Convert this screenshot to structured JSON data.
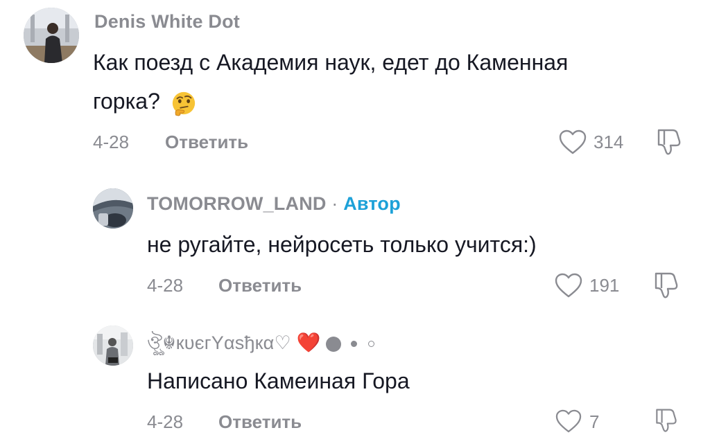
{
  "comments": [
    {
      "username": "Denis White Dot",
      "text_line1": "Как поезд с Академия наук, едет до Каменная",
      "text_line2": "горка?",
      "emoji": "thinking-face-icon",
      "date": "4-28",
      "reply_label": "Ответить",
      "likes": "314"
    },
    {
      "username": "TOMORROW_LAND",
      "separator": "·",
      "author_tag": "Автор",
      "text": "не ругайте, нейросеть только учится:)",
      "date": "4-28",
      "reply_label": "Ответить",
      "likes": "191"
    },
    {
      "username": "ঔৣ☬кυєгYαѕђкα♡",
      "heart": "❤️",
      "text": "Написано Камеиная Гора",
      "date": "4-28",
      "reply_label": "Ответить",
      "likes": "7"
    }
  ],
  "colors": {
    "text": "#161823",
    "muted": "#8a8b91",
    "author_tag": "#1da1d8",
    "heart_red": "#e8102a"
  }
}
